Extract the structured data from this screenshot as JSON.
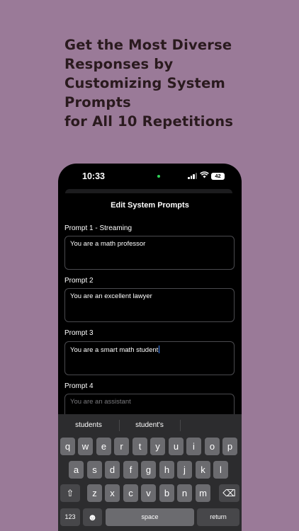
{
  "headline": {
    "lines": [
      "Get the Most Diverse",
      "Responses by",
      "Customizing System",
      "Prompts",
      "for All 10 Repetitions"
    ]
  },
  "status_bar": {
    "time": "10:33",
    "battery": "42"
  },
  "screen": {
    "title": "Edit System Prompts",
    "prompts": [
      {
        "label": "Prompt 1 - Streaming",
        "value": "You are a math professor",
        "placeholder": ""
      },
      {
        "label": "Prompt 2",
        "value": "You are an excellent lawyer",
        "placeholder": ""
      },
      {
        "label": "Prompt 3",
        "value": "You are a smart math student",
        "placeholder": ""
      },
      {
        "label": "Prompt 4",
        "value": "",
        "placeholder": "You are an assistant"
      }
    ]
  },
  "keyboard": {
    "suggestions": [
      "students",
      "student's"
    ],
    "row1": [
      "q",
      "w",
      "e",
      "r",
      "t",
      "y",
      "u",
      "i",
      "o",
      "p"
    ],
    "row2": [
      "a",
      "s",
      "d",
      "f",
      "g",
      "h",
      "j",
      "k",
      "l"
    ],
    "row3": [
      "z",
      "x",
      "c",
      "v",
      "b",
      "n",
      "m"
    ],
    "numbers_key": "123",
    "space_key": "space",
    "return_key": "return",
    "shift_glyph": "⇧",
    "delete_glyph": "⌫",
    "emoji_glyph": "☻"
  },
  "colors": {
    "background": "#9a7a98",
    "headline": "#2a1a1e",
    "caret": "#3b82f6"
  }
}
